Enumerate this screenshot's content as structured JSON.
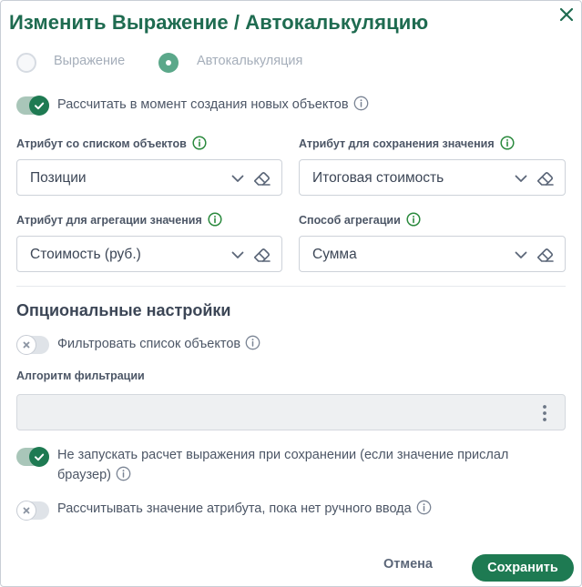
{
  "dialog": {
    "title": "Изменить Выражение / Автокалькуляцию"
  },
  "mode": {
    "options": [
      "Выражение",
      "Автокалькуляция"
    ],
    "selected": "Автокалькуляция"
  },
  "toggles": {
    "calc_on_create": {
      "label": "Рассчитать в момент создания новых объектов",
      "on": true
    },
    "filter_list": {
      "label": "Фильтровать список объектов",
      "on": false
    },
    "no_calc_on_save": {
      "label_line1": "Не запускать расчет выражения при сохранении (если значение прислал",
      "label_line2": "браузер)",
      "on": true
    },
    "calc_until_manual": {
      "label": "Рассчитывать значение атрибута, пока нет ручного ввода",
      "on": false
    }
  },
  "fields": {
    "list_attr": {
      "label": "Атрибут со списком объектов",
      "value": "Позиции"
    },
    "save_attr": {
      "label": "Атрибут для сохранения значения",
      "value": "Итоговая стоимость"
    },
    "agg_attr": {
      "label": "Атрибут для агрегации значения",
      "value": "Стоимость (руб.)"
    },
    "agg_method": {
      "label": "Способ агрегации",
      "value": "Сумма"
    }
  },
  "optional": {
    "title": "Опциональные настройки",
    "filter_algorithm_label": "Алгоритм фильтрации",
    "filter_algorithm_value": ""
  },
  "footer": {
    "cancel_label": "Отмена",
    "save_label": "Сохранить"
  },
  "colors": {
    "brand_green": "#1e7a52",
    "title_green": "#1e6b50",
    "muted_text": "#a5aeba"
  },
  "icons": [
    "close-icon",
    "info-icon",
    "info-green-icon",
    "chevron-down-icon",
    "eraser-icon",
    "check-icon",
    "x-icon",
    "kebab-icon"
  ]
}
